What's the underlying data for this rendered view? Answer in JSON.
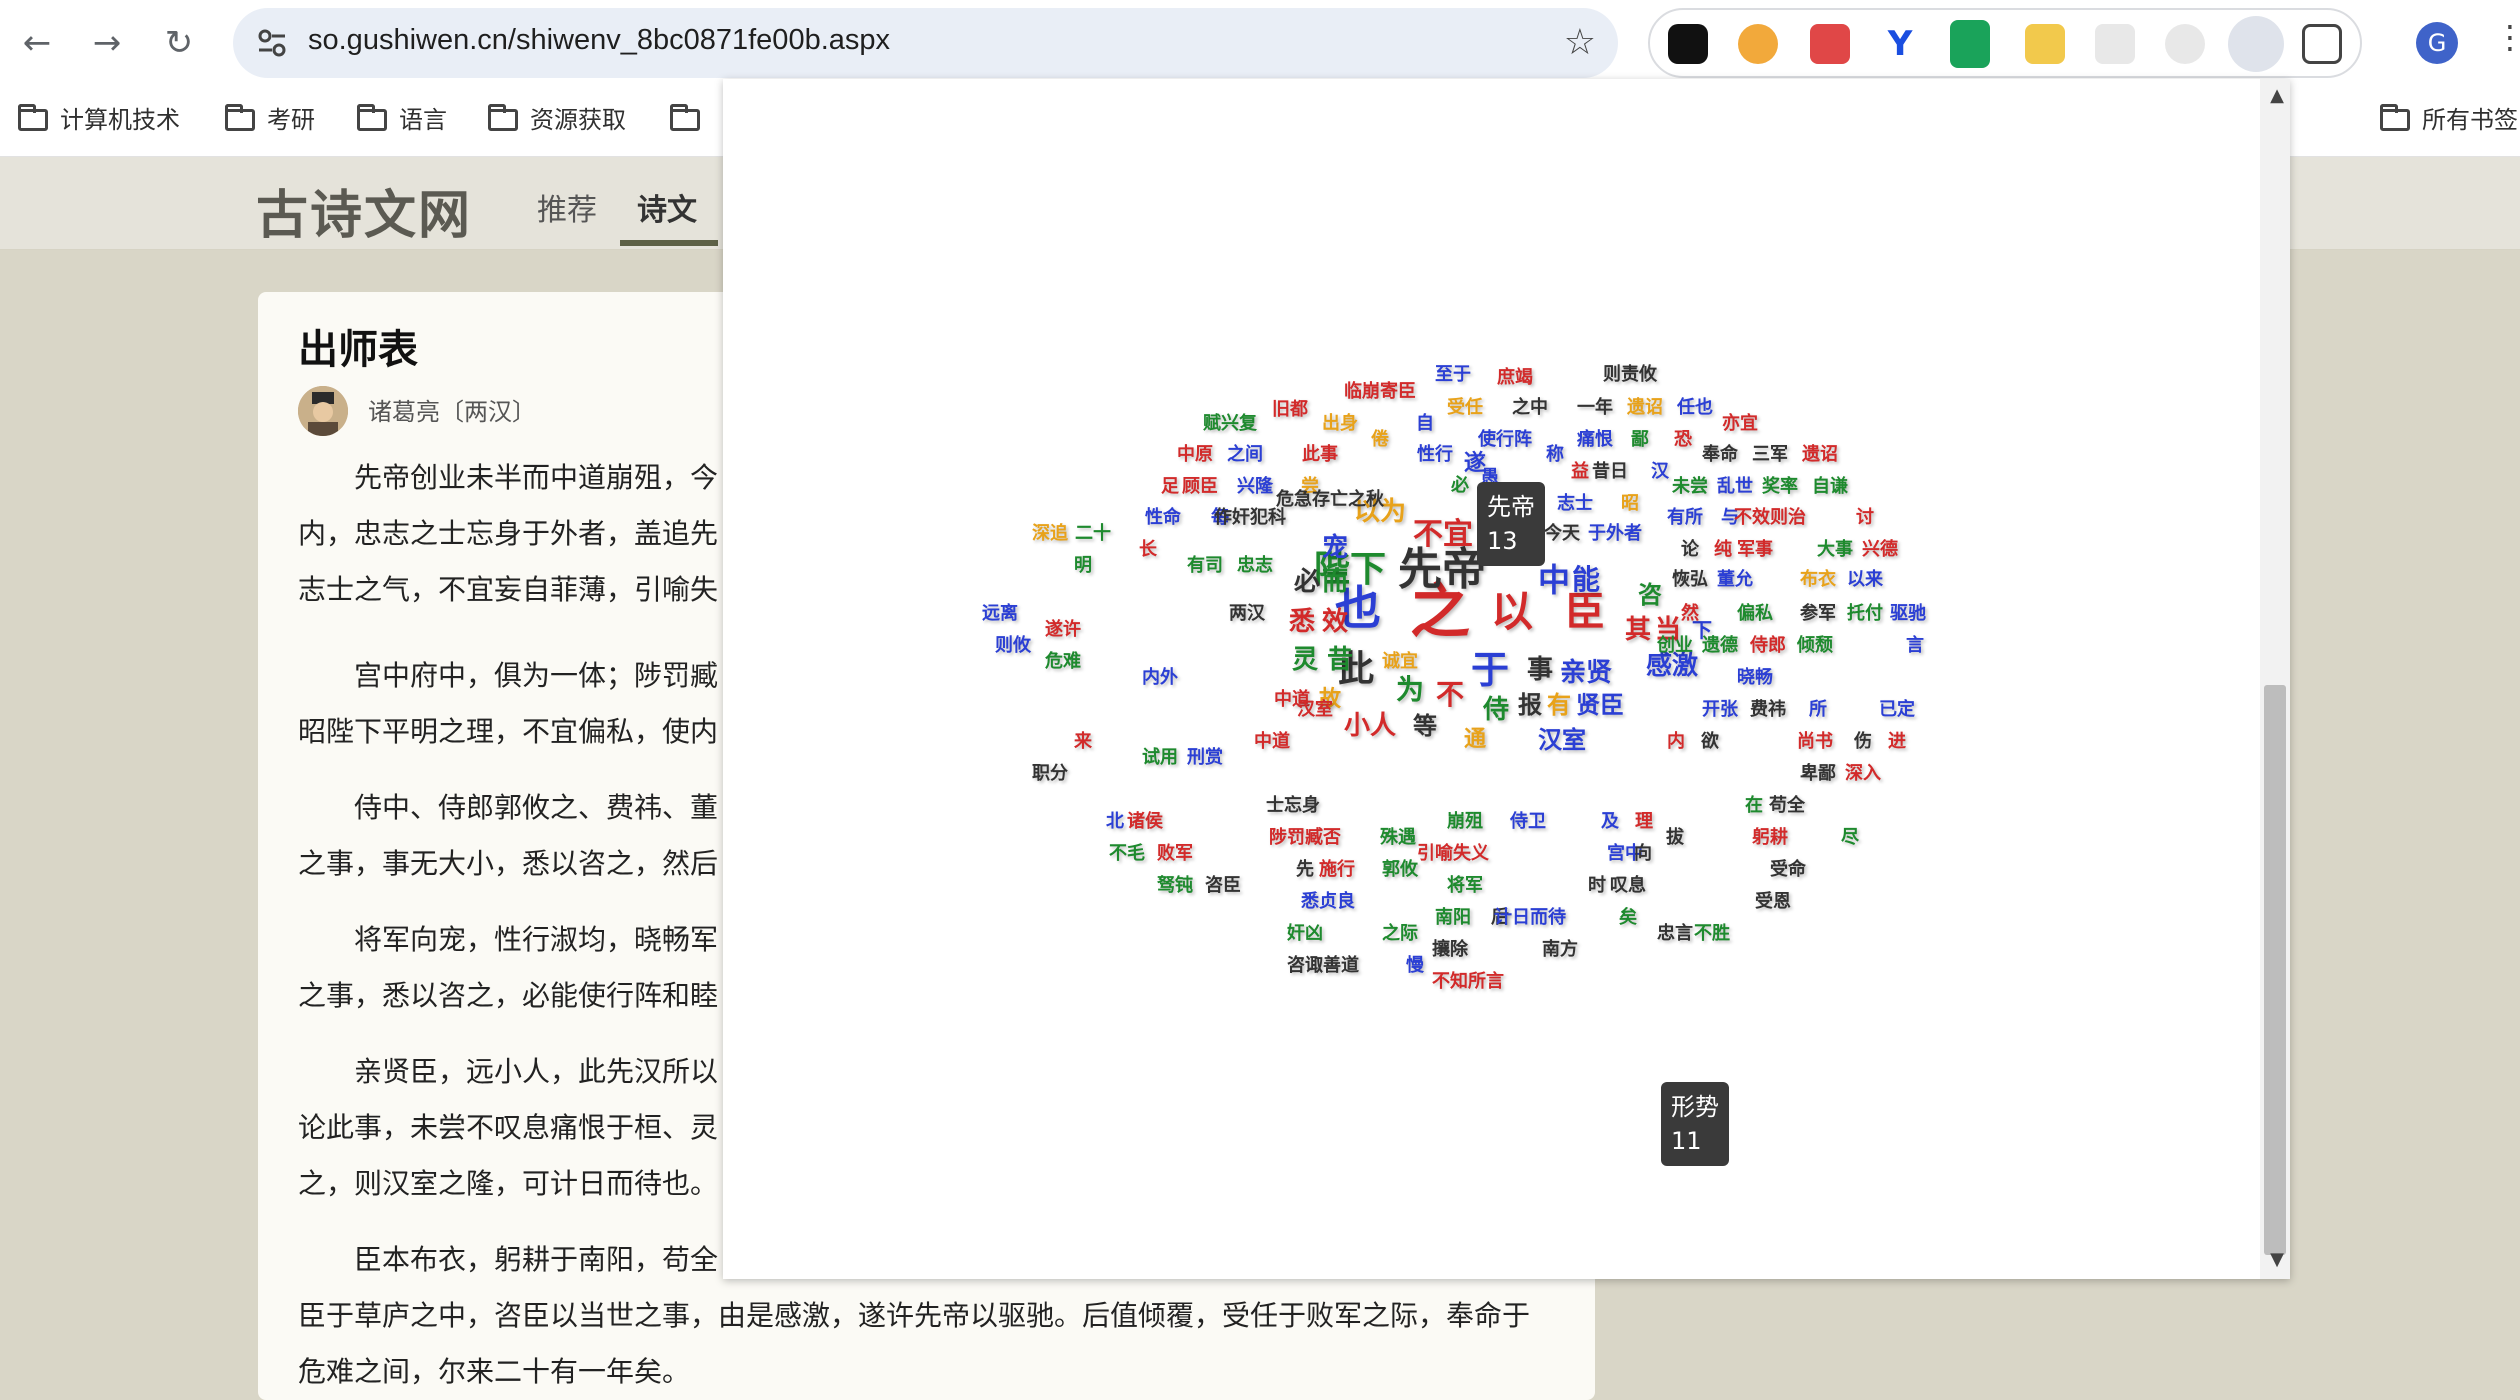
{
  "browser": {
    "url": "so.gushiwen.cn/shiwenv_8bc0871fe00b.aspx",
    "profile_initial": "G",
    "bookmarks": [
      "计算机技术",
      "考研",
      "语言",
      "资源获取",
      "所有书签"
    ]
  },
  "site": {
    "logo": "古诗文网",
    "nav": [
      "推荐",
      "诗文"
    ]
  },
  "article": {
    "title": "出师表",
    "author": "诸葛亮〔两汉〕",
    "paragraphs": [
      [
        "先帝创业未半而中道崩殂，今",
        "内，忠志之士忘身于外者，盖追先",
        "志士之气，不宜妄自菲薄，引喻失"
      ],
      [
        "宫中府中，俱为一体；陟罚臧",
        "昭陛下平明之理，不宜偏私，使内"
      ],
      [
        "侍中、侍郎郭攸之、费祎、董",
        "之事，事无大小，悉以咨之，然后"
      ],
      [
        "将军向宠，性行淑均，晓畅军",
        "之事，悉以咨之，必能使行阵和睦"
      ],
      [
        "亲贤臣，远小人，此先汉所以",
        "论此事，未尝不叹息痛恨于桓、灵",
        "之，则汉室之隆，可计日而待也。"
      ],
      [
        "臣本布衣，躬耕于南阳，苟全",
        "臣于草庐之中，咨臣以当世之事，由是感激，遂许先帝以驱驰。后值倾覆，受任于败军之际，奉命于",
        "危难之间，尔来二十有一年矣。"
      ]
    ]
  },
  "wordcloud": {
    "tooltips": [
      {
        "word": "先帝",
        "count": "13"
      },
      {
        "word": "形势",
        "count": "11"
      }
    ],
    "colors": {
      "r": "#d22a2a",
      "g": "#1e8a2e",
      "b": "#2b3fd4",
      "o": "#e8a21a",
      "k": "#333333"
    },
    "words": [
      [
        "之",
        1440,
        612,
        60,
        "r"
      ],
      [
        "以",
        1512,
        612,
        42,
        "r"
      ],
      [
        "臣",
        1585,
        612,
        40,
        "r"
      ],
      [
        "先帝",
        1442,
        570,
        44,
        "k"
      ],
      [
        "也",
        1358,
        608,
        46,
        "b"
      ],
      [
        "陛下",
        1350,
        570,
        36,
        "g"
      ],
      [
        "此",
        1356,
        670,
        36,
        "k"
      ],
      [
        "于",
        1490,
        670,
        38,
        "b"
      ],
      [
        "中",
        1554,
        580,
        32,
        "b"
      ],
      [
        "能",
        1586,
        580,
        28,
        "b"
      ],
      [
        "不宜",
        1443,
        535,
        30,
        "r"
      ],
      [
        "所以",
        1510,
        540,
        28,
        "o"
      ],
      [
        "以为",
        1380,
        512,
        26,
        "o"
      ],
      [
        "宠",
        1335,
        548,
        26,
        "b"
      ],
      [
        "而",
        1335,
        582,
        26,
        "g"
      ],
      [
        "必",
        1307,
        582,
        26,
        "k"
      ],
      [
        "悉",
        1302,
        622,
        26,
        "r"
      ],
      [
        "效",
        1335,
        622,
        26,
        "r"
      ],
      [
        "灵",
        1305,
        660,
        26,
        "g"
      ],
      [
        "昔",
        1340,
        660,
        26,
        "g"
      ],
      [
        "为",
        1410,
        690,
        28,
        "g"
      ],
      [
        "不",
        1450,
        695,
        28,
        "r"
      ],
      [
        "侍",
        1496,
        710,
        26,
        "g"
      ],
      [
        "事",
        1540,
        670,
        26,
        "k"
      ],
      [
        "亲贤",
        1586,
        673,
        26,
        "b"
      ],
      [
        "报",
        1530,
        705,
        24,
        "k"
      ],
      [
        "有",
        1559,
        705,
        24,
        "o"
      ],
      [
        "贤臣",
        1600,
        705,
        24,
        "b"
      ],
      [
        "汉室",
        1562,
        740,
        24,
        "b"
      ],
      [
        "其",
        1638,
        630,
        26,
        "r"
      ],
      [
        "当",
        1668,
        630,
        26,
        "r"
      ],
      [
        "下",
        1702,
        630,
        20,
        "b"
      ],
      [
        "咨",
        1650,
        595,
        24,
        "g"
      ],
      [
        "感激",
        1672,
        666,
        26,
        "b"
      ],
      [
        "小人",
        1370,
        726,
        26,
        "r"
      ],
      [
        "等",
        1425,
        726,
        24,
        "k"
      ],
      [
        "通",
        1475,
        740,
        22,
        "o"
      ],
      [
        "故",
        1330,
        700,
        22,
        "o"
      ],
      [
        "中道",
        1292,
        700,
        18,
        "r"
      ],
      [
        "遂",
        1475,
        464,
        22,
        "b"
      ],
      [
        "至于",
        1453,
        375,
        18,
        "b"
      ],
      [
        "临崩寄臣",
        1380,
        392,
        18,
        "r"
      ],
      [
        "受任",
        1465,
        408,
        18,
        "o"
      ],
      [
        "庶竭",
        1515,
        378,
        18,
        "r"
      ],
      [
        "则责攸",
        1630,
        375,
        18,
        "k"
      ],
      [
        "旧都",
        1290,
        410,
        18,
        "r"
      ],
      [
        "赋兴复",
        1230,
        424,
        18,
        "g"
      ],
      [
        "之中",
        1530,
        408,
        18,
        "k"
      ],
      [
        "一年",
        1595,
        408,
        18,
        "k"
      ],
      [
        "遗诏",
        1645,
        408,
        18,
        "o"
      ],
      [
        "任也",
        1695,
        408,
        18,
        "b"
      ],
      [
        "亦宜",
        1740,
        424,
        18,
        "r"
      ],
      [
        "出身",
        1340,
        424,
        18,
        "o"
      ],
      [
        "倦",
        1380,
        440,
        18,
        "o"
      ],
      [
        "自",
        1425,
        424,
        18,
        "b"
      ],
      [
        "使行阵",
        1505,
        440,
        18,
        "b"
      ],
      [
        "痛恨",
        1595,
        440,
        18,
        "b"
      ],
      [
        "鄙",
        1640,
        440,
        18,
        "g"
      ],
      [
        "恐",
        1683,
        440,
        18,
        "r"
      ],
      [
        "中原",
        1195,
        455,
        18,
        "r"
      ],
      [
        "之间",
        1245,
        455,
        18,
        "b"
      ],
      [
        "此事",
        1320,
        455,
        18,
        "r"
      ],
      [
        "性行",
        1435,
        455,
        18,
        "b"
      ],
      [
        "称",
        1555,
        455,
        18,
        "b"
      ],
      [
        "奉命",
        1720,
        455,
        18,
        "k"
      ],
      [
        "三军",
        1770,
        455,
        18,
        "k"
      ],
      [
        "遗诏",
        1820,
        455,
        18,
        "r"
      ],
      [
        "足",
        1170,
        487,
        18,
        "r"
      ],
      [
        "顾臣",
        1200,
        487,
        18,
        "r"
      ],
      [
        "兴隆",
        1255,
        487,
        18,
        "b"
      ],
      [
        "尝",
        1310,
        487,
        18,
        "o"
      ],
      [
        "益",
        1580,
        472,
        18,
        "r"
      ],
      [
        "昔日",
        1610,
        472,
        18,
        "k"
      ],
      [
        "汉",
        1660,
        472,
        18,
        "b"
      ],
      [
        "未尝",
        1690,
        487,
        18,
        "g"
      ],
      [
        "乱世",
        1735,
        487,
        18,
        "b"
      ],
      [
        "奖率",
        1780,
        487,
        18,
        "g"
      ],
      [
        "自谦",
        1830,
        487,
        18,
        "g"
      ],
      [
        "性命",
        1163,
        518,
        18,
        "b"
      ],
      [
        "每",
        1220,
        518,
        18,
        "b"
      ],
      [
        "作奸犯科",
        1250,
        518,
        18,
        "k"
      ],
      [
        "志士",
        1575,
        504,
        18,
        "b"
      ],
      [
        "昭",
        1630,
        504,
        18,
        "o"
      ],
      [
        "有所",
        1685,
        518,
        18,
        "b"
      ],
      [
        "与",
        1730,
        518,
        18,
        "b"
      ],
      [
        "不效则治",
        1770,
        518,
        18,
        "r"
      ],
      [
        "讨",
        1865,
        518,
        18,
        "r"
      ],
      [
        "深追",
        1050,
        534,
        18,
        "o"
      ],
      [
        "二十",
        1093,
        534,
        18,
        "g"
      ],
      [
        "今天",
        1562,
        534,
        18,
        "k"
      ],
      [
        "于外者",
        1615,
        534,
        18,
        "b"
      ],
      [
        "论",
        1690,
        550,
        18,
        "k"
      ],
      [
        "纯",
        1723,
        550,
        18,
        "r"
      ],
      [
        "军事",
        1755,
        550,
        18,
        "r"
      ],
      [
        "大事",
        1835,
        550,
        18,
        "g"
      ],
      [
        "兴德",
        1880,
        550,
        18,
        "r"
      ],
      [
        "明",
        1083,
        566,
        18,
        "g"
      ],
      [
        "长",
        1148,
        550,
        18,
        "r"
      ],
      [
        "有司",
        1205,
        566,
        18,
        "g"
      ],
      [
        "忠志",
        1255,
        566,
        18,
        "g"
      ],
      [
        "恢弘",
        1690,
        580,
        18,
        "k"
      ],
      [
        "董允",
        1735,
        580,
        18,
        "b"
      ],
      [
        "布衣",
        1818,
        580,
        18,
        "o"
      ],
      [
        "以来",
        1865,
        580,
        18,
        "b"
      ],
      [
        "远离",
        1000,
        614,
        18,
        "b"
      ],
      [
        "遂许",
        1063,
        630,
        18,
        "r"
      ],
      [
        "两汉",
        1247,
        614,
        18,
        "k"
      ],
      [
        "然",
        1690,
        614,
        18,
        "r"
      ],
      [
        "偏私",
        1755,
        614,
        18,
        "g"
      ],
      [
        "参军",
        1818,
        614,
        18,
        "k"
      ],
      [
        "托付",
        1865,
        614,
        18,
        "g"
      ],
      [
        "驱驰",
        1908,
        614,
        18,
        "b"
      ],
      [
        "则攸",
        1013,
        646,
        18,
        "b"
      ],
      [
        "危难",
        1063,
        662,
        18,
        "g"
      ],
      [
        "内外",
        1160,
        678,
        18,
        "b"
      ],
      [
        "创业",
        1675,
        646,
        18,
        "g"
      ],
      [
        "遗德",
        1720,
        646,
        18,
        "g"
      ],
      [
        "侍郎",
        1768,
        646,
        18,
        "r"
      ],
      [
        "倾颓",
        1815,
        646,
        18,
        "g"
      ],
      [
        "言",
        1915,
        646,
        18,
        "b"
      ],
      [
        "诚宜",
        1400,
        662,
        18,
        "o"
      ],
      [
        "开张",
        1720,
        710,
        18,
        "b"
      ],
      [
        "费祎",
        1768,
        710,
        18,
        "k"
      ],
      [
        "所",
        1818,
        710,
        18,
        "b"
      ],
      [
        "已定",
        1897,
        710,
        18,
        "b"
      ],
      [
        "来",
        1083,
        742,
        18,
        "r"
      ],
      [
        "试用",
        1160,
        758,
        18,
        "g"
      ],
      [
        "刑赏",
        1205,
        758,
        18,
        "b"
      ],
      [
        "中道",
        1272,
        742,
        18,
        "r"
      ],
      [
        "内",
        1676,
        742,
        18,
        "r"
      ],
      [
        "欲",
        1710,
        742,
        18,
        "k"
      ],
      [
        "尚书",
        1815,
        742,
        18,
        "r"
      ],
      [
        "伤",
        1863,
        742,
        18,
        "k"
      ],
      [
        "进",
        1897,
        742,
        18,
        "r"
      ],
      [
        "职分",
        1050,
        774,
        18,
        "k"
      ],
      [
        "卑鄙",
        1818,
        774,
        18,
        "k"
      ],
      [
        "深入",
        1863,
        774,
        18,
        "r"
      ],
      [
        "北",
        1115,
        822,
        18,
        "b"
      ],
      [
        "诸侯",
        1145,
        822,
        18,
        "r"
      ],
      [
        "崩殂",
        1465,
        822,
        18,
        "g"
      ],
      [
        "侍卫",
        1528,
        822,
        18,
        "b"
      ],
      [
        "及",
        1610,
        822,
        18,
        "b"
      ],
      [
        "理",
        1644,
        822,
        18,
        "r"
      ],
      [
        "在",
        1754,
        806,
        18,
        "g"
      ],
      [
        "苟全",
        1787,
        806,
        18,
        "k"
      ],
      [
        "不毛",
        1127,
        854,
        18,
        "g"
      ],
      [
        "败军",
        1175,
        854,
        18,
        "r"
      ],
      [
        "陟罚臧否",
        1305,
        838,
        18,
        "r"
      ],
      [
        "殊遇",
        1398,
        838,
        18,
        "g"
      ],
      [
        "拔",
        1675,
        838,
        18,
        "k"
      ],
      [
        "躬耕",
        1770,
        838,
        18,
        "r"
      ],
      [
        "尽",
        1850,
        838,
        18,
        "g"
      ],
      [
        "先",
        1305,
        870,
        18,
        "k"
      ],
      [
        "施行",
        1337,
        870,
        18,
        "r"
      ],
      [
        "引喻失义",
        1453,
        854,
        18,
        "r"
      ],
      [
        "宫中",
        1625,
        854,
        18,
        "b"
      ],
      [
        "向",
        1643,
        854,
        18,
        "k"
      ],
      [
        "受命",
        1788,
        870,
        18,
        "k"
      ],
      [
        "驽钝",
        1175,
        886,
        18,
        "g"
      ],
      [
        "咨臣",
        1223,
        886,
        18,
        "k"
      ],
      [
        "将军",
        1465,
        886,
        18,
        "g"
      ],
      [
        "时",
        1597,
        886,
        18,
        "k"
      ],
      [
        "叹息",
        1628,
        886,
        18,
        "k"
      ],
      [
        "受恩",
        1773,
        902,
        18,
        "k"
      ],
      [
        "悉贞良",
        1328,
        902,
        18,
        "b"
      ],
      [
        "郭攸",
        1400,
        870,
        18,
        "g"
      ],
      [
        "南阳",
        1453,
        918,
        18,
        "g"
      ],
      [
        "后",
        1500,
        918,
        18,
        "k"
      ],
      [
        "计日而待",
        1530,
        918,
        18,
        "b"
      ],
      [
        "矣",
        1628,
        918,
        18,
        "g"
      ],
      [
        "忠言",
        1675,
        934,
        18,
        "k"
      ],
      [
        "不胜",
        1712,
        934,
        18,
        "g"
      ],
      [
        "奸凶",
        1305,
        934,
        18,
        "g"
      ],
      [
        "之际",
        1400,
        934,
        18,
        "g"
      ],
      [
        "攘除",
        1450,
        950,
        18,
        "k"
      ],
      [
        "南方",
        1560,
        950,
        18,
        "k"
      ],
      [
        "咨诹善道",
        1323,
        966,
        18,
        "k"
      ],
      [
        "慢",
        1415,
        966,
        18,
        "b"
      ],
      [
        "不知所言",
        1468,
        982,
        18,
        "r"
      ],
      [
        "士忘身",
        1293,
        806,
        18,
        "k"
      ],
      [
        "必",
        1460,
        486,
        18,
        "g"
      ],
      [
        "危急存亡之秋",
        1330,
        500,
        18,
        "k"
      ],
      [
        "晓畅",
        1755,
        678,
        18,
        "b"
      ],
      [
        "汉室",
        1315,
        710,
        18,
        "r"
      ],
      [
        "愚",
        1490,
        478,
        18,
        "b"
      ]
    ]
  }
}
